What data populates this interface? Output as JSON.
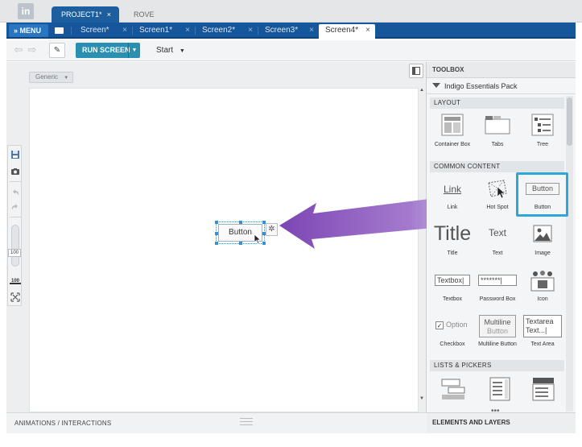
{
  "project_tabs": [
    {
      "label": "PROJECT1*",
      "active": true
    },
    {
      "label": "ROVE",
      "active": false
    }
  ],
  "menu": {
    "label": "» MENU"
  },
  "screen_tabs": [
    {
      "label": "Screen*"
    },
    {
      "label": "Screen1*"
    },
    {
      "label": "Screen2*"
    },
    {
      "label": "Screen3*"
    },
    {
      "label": "Screen4*",
      "active": true
    }
  ],
  "toolbar": {
    "run_label": "RUN SCREEN",
    "start_label": "Start"
  },
  "canvas": {
    "device_select": "Generic",
    "widget_label": "Button",
    "zoom_level": "100",
    "fit_label": "100"
  },
  "bottom": {
    "animations_label": "ANIMATIONS / INTERACTIONS"
  },
  "toolbox": {
    "title": "TOOLBOX",
    "pack": "Indigo Essentials Pack",
    "sections": {
      "layout": "LAYOUT",
      "common": "COMMON CONTENT",
      "lists": "LISTS & PICKERS"
    },
    "layout_items": [
      "Container Box",
      "Tabs",
      "Tree"
    ],
    "common_items": [
      "Link",
      "Hot Spot",
      "Button",
      "Title",
      "Text",
      "Image",
      "Textbox",
      "Password Box",
      "Icon",
      "Checkbox",
      "Multiline Button",
      "Text Area"
    ],
    "previews": {
      "link": "Link",
      "button": "Button",
      "title": "Title",
      "text": "Text",
      "textbox": "Textbox|",
      "password": "*******|",
      "option": "Option",
      "multiline_1": "Multiline",
      "multiline_2": "Button",
      "textarea_1": "Textarea",
      "textarea_2": "Text...|"
    },
    "more": "•••"
  },
  "elements_layers": "ELEMENTS AND LAYERS",
  "colors": {
    "brand_blue": "#16569b",
    "run_button": "#2a8fb0",
    "highlight": "#2ea7d8",
    "drag_arrow": "#8450b8"
  }
}
